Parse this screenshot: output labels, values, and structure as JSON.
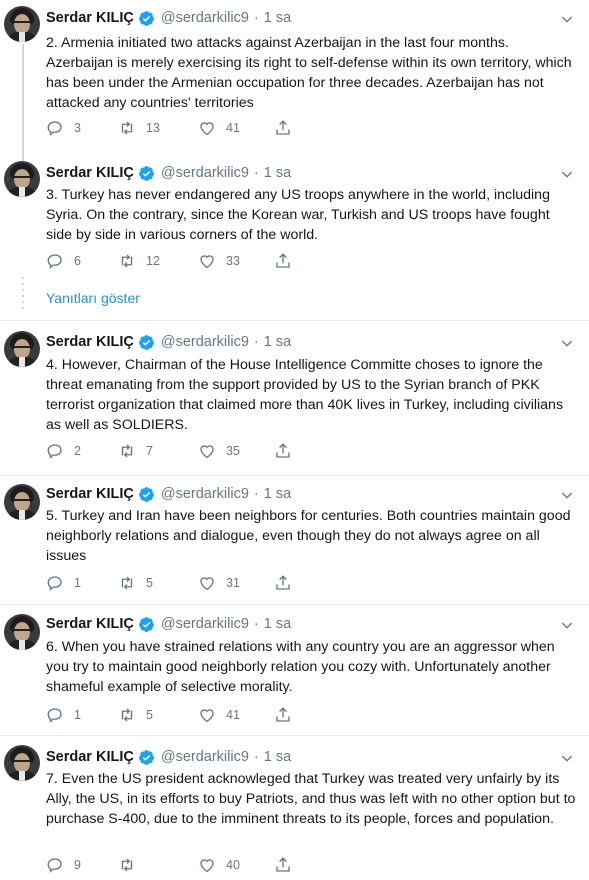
{
  "author": {
    "name": "Serdar KILIÇ",
    "handle": "@serdarkilic9",
    "time": "1 sa"
  },
  "colors": {
    "link": "#1b95e0",
    "verified": "#1da1f2",
    "muted": "#657786"
  },
  "show_replies_label": "Yanıtları göster",
  "tweets": [
    {
      "text": "2. Armenia initiated two attacks against Azerbaijan in the last four months. Azerbaijan is merely exercising its right to self-defense within its own territory, which has been under the Armenian occupation for three decades. Azerbaijan has not attacked any countries' territories",
      "replies": "3",
      "retweets": "13",
      "likes": "41"
    },
    {
      "text": "3. Turkey has never endangered any US troops anywhere in the world, including Syria. On the contrary, since the Korean war, Turkish and US troops have fought side by side in various corners of the world.",
      "replies": "6",
      "retweets": "12",
      "likes": "33"
    },
    {
      "text": "4. However, Chairman of the House Intelligence Committe choses to ignore the threat emanating from the support provided by US to the Syrian branch of PKK terrorist organization that claimed more than 40K lives in Turkey, including civilians as well as SOLDIERS.",
      "replies": "2",
      "retweets": "7",
      "likes": "35"
    },
    {
      "text": "5. Turkey and Iran have been neighbors for centuries. Both countries maintain good neighborly relations and dialogue, even though they do not always agree on all issues",
      "replies": "1",
      "retweets": "5",
      "likes": "31"
    },
    {
      "text": "6. When you have strained relations with any country you are an aggressor when you try to maintain good neighborly relation you cozy with. Unfortunately another shameful example of selective morality.",
      "replies": "1",
      "retweets": "5",
      "likes": "41"
    },
    {
      "text": "7. Even the US president acknowleged that Turkey was treated very unfairly by its Ally, the US, in its efforts to buy Patriots, and thus was left with no other option but to purchase  S-400, due to the imminent threats to its people, forces and population.",
      "replies": "9",
      "retweets": "",
      "likes": "40"
    }
  ]
}
